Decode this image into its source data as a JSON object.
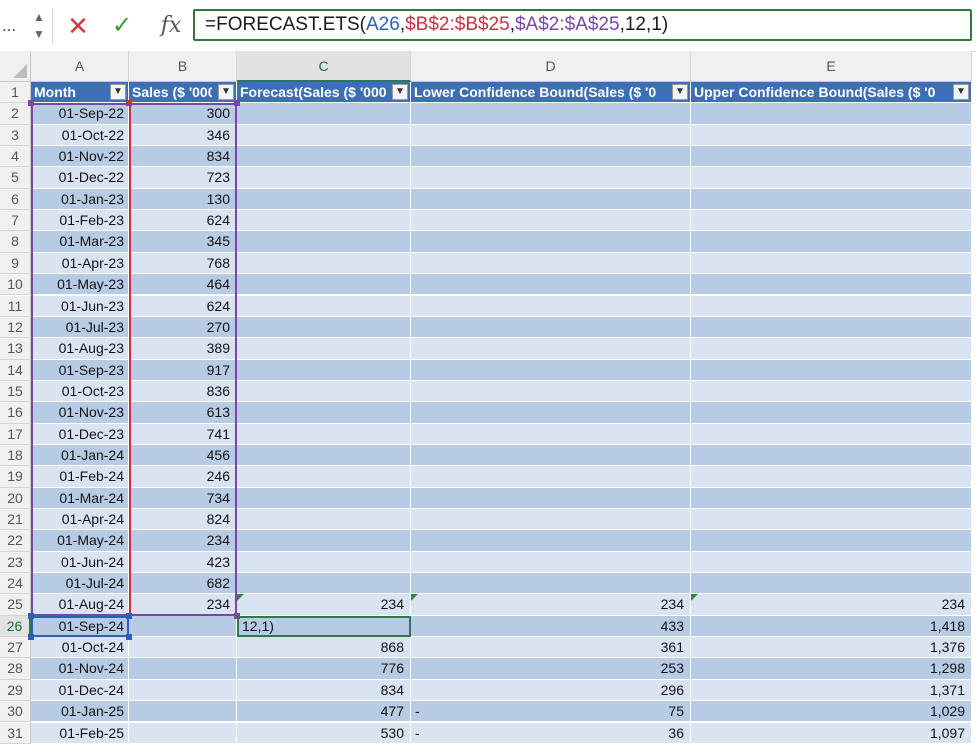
{
  "formula_bar": {
    "name_box": "...",
    "stepper_up": "▲",
    "stepper_down": "▼",
    "cancel": "✕",
    "enter": "✓",
    "fx": "fx",
    "formula_parts": [
      {
        "text": "=FORECAST.ETS(",
        "color": "default"
      },
      {
        "text": "A26",
        "color": "blue"
      },
      {
        "text": ",",
        "color": "default"
      },
      {
        "text": "$B$2:$B$25",
        "color": "red"
      },
      {
        "text": ",",
        "color": "default"
      },
      {
        "text": "$A$2:$A$25",
        "color": "purple"
      },
      {
        "text": ",12,1)",
        "color": "default"
      }
    ]
  },
  "columns": [
    "A",
    "B",
    "C",
    "D",
    "E"
  ],
  "active_column": "C",
  "active_row": "26",
  "table_headers": [
    "Month",
    "Sales ($ '000",
    "Forecast(Sales ($ '000",
    "Lower Confidence Bound(Sales ($ '0",
    "Upper Confidence Bound(Sales ($ '0"
  ],
  "filter_icon": "▼",
  "rows": [
    {
      "n": "2",
      "a": "01-Sep-22",
      "b": "300",
      "c": "",
      "d": "",
      "e": ""
    },
    {
      "n": "3",
      "a": "01-Oct-22",
      "b": "346",
      "c": "",
      "d": "",
      "e": ""
    },
    {
      "n": "4",
      "a": "01-Nov-22",
      "b": "834",
      "c": "",
      "d": "",
      "e": ""
    },
    {
      "n": "5",
      "a": "01-Dec-22",
      "b": "723",
      "c": "",
      "d": "",
      "e": ""
    },
    {
      "n": "6",
      "a": "01-Jan-23",
      "b": "130",
      "c": "",
      "d": "",
      "e": ""
    },
    {
      "n": "7",
      "a": "01-Feb-23",
      "b": "624",
      "c": "",
      "d": "",
      "e": ""
    },
    {
      "n": "8",
      "a": "01-Mar-23",
      "b": "345",
      "c": "",
      "d": "",
      "e": ""
    },
    {
      "n": "9",
      "a": "01-Apr-23",
      "b": "768",
      "c": "",
      "d": "",
      "e": ""
    },
    {
      "n": "10",
      "a": "01-May-23",
      "b": "464",
      "c": "",
      "d": "",
      "e": ""
    },
    {
      "n": "11",
      "a": "01-Jun-23",
      "b": "624",
      "c": "",
      "d": "",
      "e": ""
    },
    {
      "n": "12",
      "a": "01-Jul-23",
      "b": "270",
      "c": "",
      "d": "",
      "e": ""
    },
    {
      "n": "13",
      "a": "01-Aug-23",
      "b": "389",
      "c": "",
      "d": "",
      "e": ""
    },
    {
      "n": "14",
      "a": "01-Sep-23",
      "b": "917",
      "c": "",
      "d": "",
      "e": ""
    },
    {
      "n": "15",
      "a": "01-Oct-23",
      "b": "836",
      "c": "",
      "d": "",
      "e": ""
    },
    {
      "n": "16",
      "a": "01-Nov-23",
      "b": "613",
      "c": "",
      "d": "",
      "e": ""
    },
    {
      "n": "17",
      "a": "01-Dec-23",
      "b": "741",
      "c": "",
      "d": "",
      "e": ""
    },
    {
      "n": "18",
      "a": "01-Jan-24",
      "b": "456",
      "c": "",
      "d": "",
      "e": ""
    },
    {
      "n": "19",
      "a": "01-Feb-24",
      "b": "246",
      "c": "",
      "d": "",
      "e": ""
    },
    {
      "n": "20",
      "a": "01-Mar-24",
      "b": "734",
      "c": "",
      "d": "",
      "e": ""
    },
    {
      "n": "21",
      "a": "01-Apr-24",
      "b": "824",
      "c": "",
      "d": "",
      "e": ""
    },
    {
      "n": "22",
      "a": "01-May-24",
      "b": "234",
      "c": "",
      "d": "",
      "e": ""
    },
    {
      "n": "23",
      "a": "01-Jun-24",
      "b": "423",
      "c": "",
      "d": "",
      "e": ""
    },
    {
      "n": "24",
      "a": "01-Jul-24",
      "b": "682",
      "c": "",
      "d": "",
      "e": ""
    },
    {
      "n": "25",
      "a": "01-Aug-24",
      "b": "234",
      "c": "234",
      "d": "234",
      "e": "234",
      "flag": true
    },
    {
      "n": "26",
      "a": "01-Sep-24",
      "b": "",
      "c": "12,1)",
      "d": "433",
      "e": "1,418",
      "editing": true
    },
    {
      "n": "27",
      "a": "01-Oct-24",
      "b": "",
      "c": "868",
      "d": "361",
      "e": "1,376"
    },
    {
      "n": "28",
      "a": "01-Nov-24",
      "b": "",
      "c": "776",
      "d": "253",
      "e": "1,298"
    },
    {
      "n": "29",
      "a": "01-Dec-24",
      "b": "",
      "c": "834",
      "d": "296",
      "e": "1,371"
    },
    {
      "n": "30",
      "a": "01-Jan-25",
      "b": "",
      "c": "477",
      "d": "75",
      "e": "1,029",
      "d_dash": "-"
    },
    {
      "n": "31",
      "a": "01-Feb-25",
      "b": "",
      "c": "530",
      "d": "36",
      "e": "1,097",
      "d_dash": "-"
    }
  ],
  "header_row_number": "1",
  "colors": {
    "table_header": "#3d6fb6",
    "band_dark": "#b8cbe4",
    "band_light": "#dae3f1",
    "ref_blue": "#2c5fb8",
    "ref_red": "#c2343c",
    "ref_purple": "#7b46a8",
    "active_green": "#2f7a43"
  }
}
